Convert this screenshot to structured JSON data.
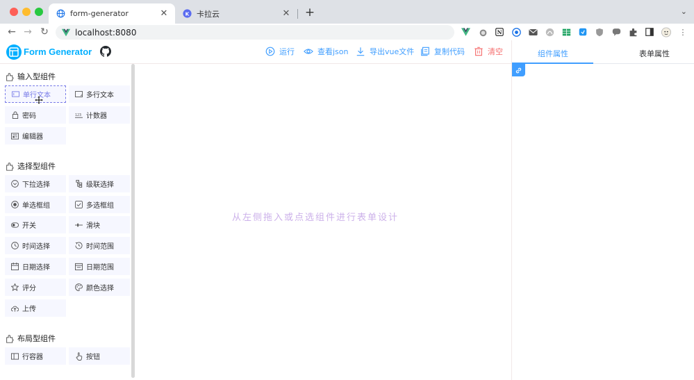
{
  "browser": {
    "tabs": [
      {
        "title": "form-generator",
        "active": true
      },
      {
        "title": "卡拉云",
        "active": false
      }
    ],
    "url": "localhost:8080"
  },
  "header": {
    "app_title": "Form Generator",
    "actions": [
      {
        "label": "运行",
        "icon": "play-circle-icon"
      },
      {
        "label": "查看json",
        "icon": "eye-icon"
      },
      {
        "label": "导出vue文件",
        "icon": "download-icon"
      },
      {
        "label": "复制代码",
        "icon": "copy-icon"
      },
      {
        "label": "清空",
        "icon": "trash-icon"
      }
    ],
    "accent": "#409eff",
    "danger": "#f56c6c"
  },
  "left_panel": {
    "groups": [
      {
        "title": "输入型组件",
        "items": [
          {
            "label": "单行文本",
            "icon": "input-icon",
            "state": "dragging"
          },
          {
            "label": "多行文本",
            "icon": "textarea-icon"
          },
          {
            "label": "密码",
            "icon": "password-icon"
          },
          {
            "label": "计数器",
            "icon": "number-icon"
          },
          {
            "label": "编辑器",
            "icon": "editor-icon"
          }
        ]
      },
      {
        "title": "选择型组件",
        "items": [
          {
            "label": "下拉选择",
            "icon": "select-icon"
          },
          {
            "label": "级联选择",
            "icon": "cascader-icon"
          },
          {
            "label": "单选框组",
            "icon": "radio-icon"
          },
          {
            "label": "多选框组",
            "icon": "checkbox-icon"
          },
          {
            "label": "开关",
            "icon": "switch-icon"
          },
          {
            "label": "滑块",
            "icon": "slider-icon"
          },
          {
            "label": "时间选择",
            "icon": "time-icon"
          },
          {
            "label": "时间范围",
            "icon": "time-range-icon"
          },
          {
            "label": "日期选择",
            "icon": "date-icon"
          },
          {
            "label": "日期范围",
            "icon": "date-range-icon"
          },
          {
            "label": "评分",
            "icon": "rate-icon"
          },
          {
            "label": "颜色选择",
            "icon": "color-icon"
          },
          {
            "label": "上传",
            "icon": "upload-icon"
          }
        ]
      },
      {
        "title": "布局型组件",
        "items": [
          {
            "label": "行容器",
            "icon": "row-icon"
          },
          {
            "label": "按钮",
            "icon": "button-icon"
          }
        ]
      }
    ]
  },
  "center": {
    "empty_text": "从左侧拖入或点选组件进行表单设计"
  },
  "right_panel": {
    "tabs": [
      {
        "label": "组件属性",
        "active": true
      },
      {
        "label": "表单属性",
        "active": false
      }
    ]
  }
}
